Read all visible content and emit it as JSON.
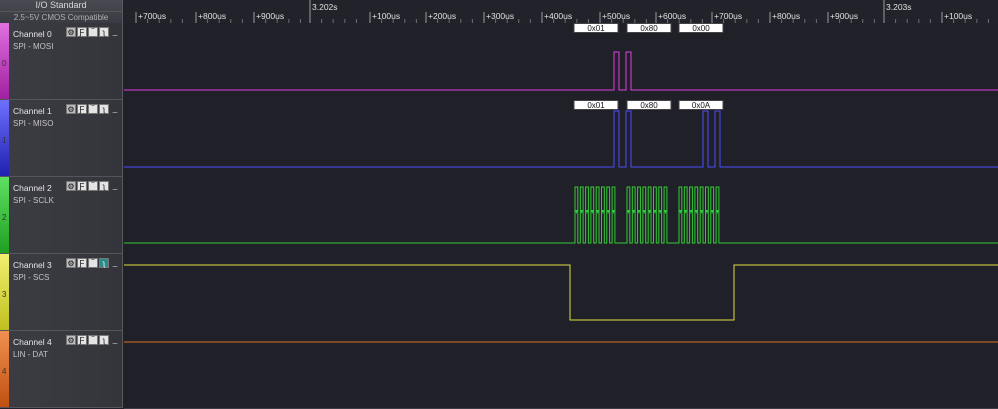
{
  "io_standard": {
    "title": "I/O Standard",
    "subtitle": "2.5~5V CMOS Compatible"
  },
  "timeline": {
    "ticks": [
      "+700us",
      "+800us",
      "+900us",
      "3.202s",
      "+100us",
      "+200us",
      "+300us",
      "+400us",
      "+500us",
      "+600us",
      "+700us",
      "+800us",
      "+900us",
      "3.203s",
      "+100us"
    ]
  },
  "channels": [
    {
      "name": "Channel 0",
      "signal": "SPI - MOSI",
      "index": "0",
      "color": "#e040e0",
      "decode": [
        "0x01",
        "0x80",
        "0x00"
      ]
    },
    {
      "name": "Channel 1",
      "signal": "SPI - MISO",
      "index": "1",
      "color": "#4d4dff",
      "decode": [
        "0x01",
        "0x80",
        "0x0A"
      ]
    },
    {
      "name": "Channel 2",
      "signal": "SPI - SCLK",
      "index": "2",
      "color": "#33cc33",
      "decode": []
    },
    {
      "name": "Channel 3",
      "signal": "SPI - SCS",
      "index": "3",
      "color": "#e0e040",
      "decode": []
    },
    {
      "name": "Channel 4",
      "signal": "LIN - DAT",
      "index": "4",
      "color": "#e07020",
      "decode": []
    }
  ],
  "buttons": {
    "gear": "⚙",
    "rise": "Ƒ",
    "high": "‾",
    "fall": "ʅ",
    "low": "_"
  }
}
